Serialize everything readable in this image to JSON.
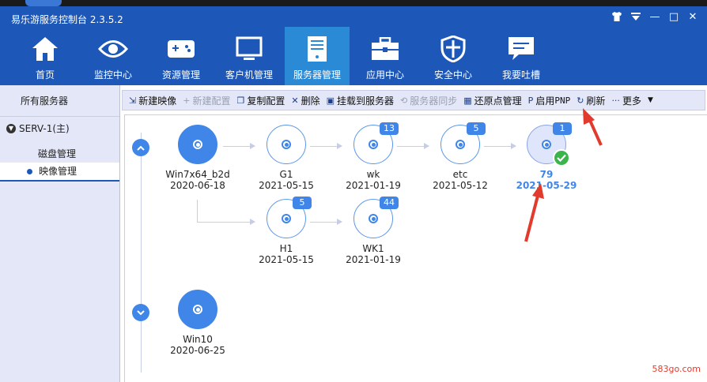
{
  "app": {
    "title": "易乐游服务控制台 2.3.5.2"
  },
  "window_controls": {
    "shirt": "shirt-icon",
    "menu": "menu-icon",
    "minimize": "—",
    "maximize": "□",
    "close": "✕"
  },
  "nav": [
    {
      "id": "home",
      "label": "首页",
      "icon": "home-icon"
    },
    {
      "id": "monitor",
      "label": "监控中心",
      "icon": "eye-icon"
    },
    {
      "id": "resource",
      "label": "资源管理",
      "icon": "gamepad-icon"
    },
    {
      "id": "client",
      "label": "客户机管理",
      "icon": "monitor-icon"
    },
    {
      "id": "server",
      "label": "服务器管理",
      "icon": "server-icon",
      "active": true
    },
    {
      "id": "app",
      "label": "应用中心",
      "icon": "toolbox-icon"
    },
    {
      "id": "security",
      "label": "安全中心",
      "icon": "shield-icon"
    },
    {
      "id": "feedback",
      "label": "我要吐槽",
      "icon": "chat-icon"
    }
  ],
  "sidebar": {
    "title": "所有服务器",
    "server": "SERV-1(主)",
    "category": "磁盘管理",
    "selected_item": "映像管理"
  },
  "toolbar": [
    {
      "id": "new-image",
      "label": "新建映像",
      "icon": "⇲",
      "disabled": false
    },
    {
      "id": "new-config",
      "label": "新建配置",
      "icon": "+",
      "disabled": true
    },
    {
      "id": "copy-config",
      "label": "复制配置",
      "icon": "❐",
      "disabled": false
    },
    {
      "id": "delete",
      "label": "删除",
      "icon": "✕",
      "disabled": false
    },
    {
      "id": "mount",
      "label": "挂载到服务器",
      "icon": "▣",
      "disabled": false
    },
    {
      "id": "sync",
      "label": "服务器同步",
      "icon": "⟲",
      "disabled": true
    },
    {
      "id": "restore",
      "label": "还原点管理",
      "icon": "▦",
      "disabled": false
    },
    {
      "id": "pnp",
      "label": "启用",
      "suffix": "PNP",
      "icon": "P",
      "disabled": false
    },
    {
      "id": "refresh",
      "label": "刷新",
      "icon": "↻",
      "disabled": false
    },
    {
      "id": "more",
      "label": "更多",
      "icon": "···",
      "disabled": false
    }
  ],
  "images": {
    "win7": {
      "name": "Win7x64_b2d",
      "date": "2020-06-18"
    },
    "g1": {
      "name": "G1",
      "date": "2021-05-15"
    },
    "wk": {
      "name": "wk",
      "date": "2021-01-19",
      "badge": "13"
    },
    "etc": {
      "name": "etc",
      "date": "2021-05-12",
      "badge": "5"
    },
    "n79": {
      "name": "79",
      "date": "2021-05-29",
      "badge": "1"
    },
    "h1": {
      "name": "H1",
      "date": "2021-05-15",
      "badge": "5"
    },
    "wk1": {
      "name": "WK1",
      "date": "2021-01-19",
      "badge": "44"
    },
    "win10": {
      "name": "Win10",
      "date": "2020-06-25"
    }
  },
  "watermark": "583go.com",
  "colors": {
    "header": "#1d58b8",
    "accent": "#3f86e8",
    "active_tab": "#2b8ad6",
    "sidebar": "#e4e7f7",
    "check": "#3ab54a",
    "annotation": "#e23b2e"
  }
}
